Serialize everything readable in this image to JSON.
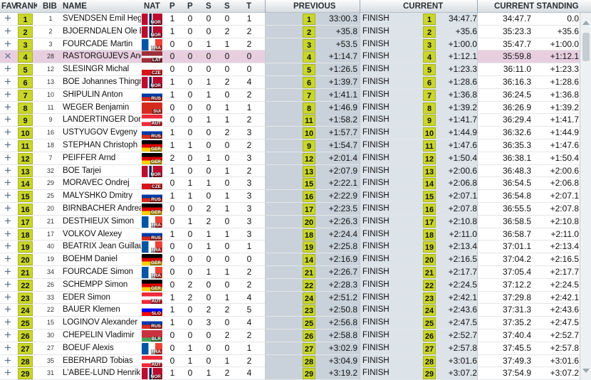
{
  "header": {
    "fav": "FAV",
    "rank": "RANK",
    "bib": "BIB",
    "name": "NAME",
    "nat": "NAT",
    "p1": "P",
    "p2": "P",
    "s1": "S",
    "s2": "S",
    "t": "T",
    "previous": "PREVIOUS",
    "current": "CURRENT",
    "standing": "CURRENT STANDING"
  },
  "colors": {
    "rank_badge": "#c9d62b",
    "selected_row": "#e8cfe0",
    "previous_band": "#c9d2da",
    "current_band": "#dce3e9",
    "fav_icon": "#5c6f86"
  },
  "selected_rank": "4",
  "rows": [
    {
      "fav": "+",
      "rank": "1",
      "bib": "1",
      "name": "SVENDSEN Emil Hegle",
      "nat": "NOR",
      "p1": "1",
      "p2": "0",
      "s1": "0",
      "s2": "0",
      "t": "1",
      "prank": "1",
      "ptime": "33:00.3",
      "status": "FINISH",
      "crank": "1",
      "ctime": "34:47.7",
      "stime": "34:47.7",
      "sdiff": "0.0"
    },
    {
      "fav": "+",
      "rank": "2",
      "bib": "2",
      "name": "BJOERNDALEN Ole Ein",
      "nat": "NOR",
      "p1": "1",
      "p2": "0",
      "s1": "0",
      "s2": "2",
      "t": "2",
      "prank": "2",
      "ptime": "+35.8",
      "status": "FINISH",
      "crank": "2",
      "ctime": "+35.6",
      "stime": "35:23.3",
      "sdiff": "+35.6"
    },
    {
      "fav": "+",
      "rank": "3",
      "bib": "3",
      "name": "FOURCADE Martin",
      "nat": "FRA",
      "p1": "0",
      "p2": "0",
      "s1": "1",
      "s2": "1",
      "t": "2",
      "prank": "3",
      "ptime": "+53.5",
      "status": "FINISH",
      "crank": "3",
      "ctime": "+1:00.0",
      "stime": "35:47.7",
      "sdiff": "+1:00.0"
    },
    {
      "fav": "×",
      "rank": "4",
      "bib": "28",
      "name": "RASTORGUJEVS Andre",
      "nat": "LAT",
      "p1": "0",
      "p2": "0",
      "s1": "0",
      "s2": "0",
      "t": "0",
      "prank": "4",
      "ptime": "+1:14.7",
      "status": "FINISH",
      "crank": "4",
      "ctime": "+1:12.1",
      "stime": "35:59.8",
      "sdiff": "+1:12.1"
    },
    {
      "fav": "+",
      "rank": "5",
      "bib": "12",
      "name": "SLESINGR Michal",
      "nat": "CZE",
      "p1": "0",
      "p2": "0",
      "s1": "0",
      "s2": "0",
      "t": "0",
      "prank": "5",
      "ptime": "+1:26.5",
      "status": "FINISH",
      "crank": "5",
      "ctime": "+1:23.3",
      "stime": "36:11.0",
      "sdiff": "+1:23.3"
    },
    {
      "fav": "+",
      "rank": "6",
      "bib": "13",
      "name": "BOE Johannes Thingn",
      "nat": "NOR",
      "p1": "1",
      "p2": "0",
      "s1": "1",
      "s2": "2",
      "t": "4",
      "prank": "6",
      "ptime": "+1:39.7",
      "status": "FINISH",
      "crank": "6",
      "ctime": "+1:28.6",
      "stime": "36:16.3",
      "sdiff": "+1:28.6"
    },
    {
      "fav": "+",
      "rank": "7",
      "bib": "10",
      "name": "SHIPULIN Anton",
      "nat": "RUS",
      "p1": "1",
      "p2": "0",
      "s1": "1",
      "s2": "0",
      "t": "2",
      "prank": "7",
      "ptime": "+1:41.1",
      "status": "FINISH",
      "crank": "7",
      "ctime": "+1:36.8",
      "stime": "36:24.5",
      "sdiff": "+1:36.8"
    },
    {
      "fav": "+",
      "rank": "8",
      "bib": "11",
      "name": "WEGER Benjamin",
      "nat": "SUI",
      "p1": "0",
      "p2": "0",
      "s1": "0",
      "s2": "1",
      "t": "1",
      "prank": "8",
      "ptime": "+1:46.9",
      "status": "FINISH",
      "crank": "8",
      "ctime": "+1:39.2",
      "stime": "36:26.9",
      "sdiff": "+1:39.2"
    },
    {
      "fav": "+",
      "rank": "9",
      "bib": "9",
      "name": "LANDERTINGER Domir",
      "nat": "AUT",
      "p1": "0",
      "p2": "0",
      "s1": "1",
      "s2": "1",
      "t": "2",
      "prank": "11",
      "ptime": "+1:58.2",
      "status": "FINISH",
      "crank": "9",
      "ctime": "+1:41.7",
      "stime": "36:29.4",
      "sdiff": "+1:41.7"
    },
    {
      "fav": "+",
      "rank": "10",
      "bib": "16",
      "name": "USTYUGOV Evgeny",
      "nat": "RUS",
      "p1": "1",
      "p2": "0",
      "s1": "0",
      "s2": "2",
      "t": "3",
      "prank": "10",
      "ptime": "+1:57.7",
      "status": "FINISH",
      "crank": "10",
      "ctime": "+1:44.9",
      "stime": "36:32.6",
      "sdiff": "+1:44.9"
    },
    {
      "fav": "+",
      "rank": "11",
      "bib": "18",
      "name": "STEPHAN Christoph",
      "nat": "GER",
      "p1": "1",
      "p2": "1",
      "s1": "0",
      "s2": "0",
      "t": "2",
      "prank": "9",
      "ptime": "+1:54.7",
      "status": "FINISH",
      "crank": "11",
      "ctime": "+1:47.6",
      "stime": "36:35.3",
      "sdiff": "+1:47.6"
    },
    {
      "fav": "+",
      "rank": "12",
      "bib": "7",
      "name": "PEIFFER Arnd",
      "nat": "GER",
      "p1": "2",
      "p2": "0",
      "s1": "1",
      "s2": "0",
      "t": "3",
      "prank": "12",
      "ptime": "+2:01.4",
      "status": "FINISH",
      "crank": "12",
      "ctime": "+1:50.4",
      "stime": "36:38.1",
      "sdiff": "+1:50.4"
    },
    {
      "fav": "+",
      "rank": "13",
      "bib": "32",
      "name": "BOE Tarjei",
      "nat": "NOR",
      "p1": "1",
      "p2": "0",
      "s1": "0",
      "s2": "1",
      "t": "2",
      "prank": "13",
      "ptime": "+2:07.9",
      "status": "FINISH",
      "crank": "13",
      "ctime": "+2:00.6",
      "stime": "36:48.3",
      "sdiff": "+2:00.6"
    },
    {
      "fav": "+",
      "rank": "14",
      "bib": "29",
      "name": "MORAVEC Ondrej",
      "nat": "CZE",
      "p1": "0",
      "p2": "1",
      "s1": "1",
      "s2": "0",
      "t": "3",
      "prank": "15",
      "ptime": "+2:22.1",
      "status": "FINISH",
      "crank": "14",
      "ctime": "+2:06.8",
      "stime": "36:54.5",
      "sdiff": "+2:06.8"
    },
    {
      "fav": "+",
      "rank": "15",
      "bib": "25",
      "name": "MALYSHKO Dmitry",
      "nat": "RUS",
      "p1": "1",
      "p2": "1",
      "s1": "0",
      "s2": "1",
      "t": "3",
      "prank": "16",
      "ptime": "+2:22.9",
      "status": "FINISH",
      "crank": "15",
      "ctime": "+2:07.1",
      "stime": "36:54.8",
      "sdiff": "+2:07.1"
    },
    {
      "fav": "+",
      "rank": "16",
      "bib": "20",
      "name": "BIRNBACHER Andreas",
      "nat": "GER",
      "p1": "0",
      "p2": "0",
      "s1": "2",
      "s2": "1",
      "t": "3",
      "prank": "17",
      "ptime": "+2:23.5",
      "status": "FINISH",
      "crank": "16",
      "ctime": "+2:07.8",
      "stime": "36:55.5",
      "sdiff": "+2:07.8"
    },
    {
      "fav": "+",
      "rank": "17",
      "bib": "21",
      "name": "DESTHIEUX Simon",
      "nat": "FRA",
      "p1": "0",
      "p2": "1",
      "s1": "2",
      "s2": "0",
      "t": "3",
      "prank": "20",
      "ptime": "+2:26.3",
      "status": "FINISH",
      "crank": "17",
      "ctime": "+2:10.8",
      "stime": "36:58.5",
      "sdiff": "+2:10.8"
    },
    {
      "fav": "+",
      "rank": "18",
      "bib": "17",
      "name": "VOLKOV Alexey",
      "nat": "RUS",
      "p1": "1",
      "p2": "0",
      "s1": "1",
      "s2": "1",
      "t": "3",
      "prank": "18",
      "ptime": "+2:24.4",
      "status": "FINISH",
      "crank": "18",
      "ctime": "+2:11.0",
      "stime": "36:58.7",
      "sdiff": "+2:11.0"
    },
    {
      "fav": "+",
      "rank": "19",
      "bib": "40",
      "name": "BEATRIX Jean Guillau",
      "nat": "FRA",
      "p1": "0",
      "p2": "0",
      "s1": "1",
      "s2": "0",
      "t": "1",
      "prank": "19",
      "ptime": "+2:25.8",
      "status": "FINISH",
      "crank": "19",
      "ctime": "+2:13.4",
      "stime": "37:01.1",
      "sdiff": "+2:13.4"
    },
    {
      "fav": "+",
      "rank": "20",
      "bib": "19",
      "name": "BOEHM Daniel",
      "nat": "GER",
      "p1": "0",
      "p2": "0",
      "s1": "0",
      "s2": "0",
      "t": "0",
      "prank": "14",
      "ptime": "+2:16.9",
      "status": "FINISH",
      "crank": "20",
      "ctime": "+2:16.5",
      "stime": "37:04.2",
      "sdiff": "+2:16.5"
    },
    {
      "fav": "+",
      "rank": "21",
      "bib": "34",
      "name": "FOURCADE Simon",
      "nat": "FRA",
      "p1": "0",
      "p2": "0",
      "s1": "1",
      "s2": "1",
      "t": "2",
      "prank": "21",
      "ptime": "+2:26.7",
      "status": "FINISH",
      "crank": "21",
      "ctime": "+2:17.7",
      "stime": "37:05.4",
      "sdiff": "+2:17.7"
    },
    {
      "fav": "+",
      "rank": "22",
      "bib": "26",
      "name": "SCHEMPP Simon",
      "nat": "GER",
      "p1": "0",
      "p2": "2",
      "s1": "0",
      "s2": "0",
      "t": "2",
      "prank": "22",
      "ptime": "+2:28.3",
      "status": "FINISH",
      "crank": "22",
      "ctime": "+2:24.5",
      "stime": "37:12.2",
      "sdiff": "+2:24.5"
    },
    {
      "fav": "+",
      "rank": "23",
      "bib": "33",
      "name": "EDER Simon",
      "nat": "AUT",
      "p1": "1",
      "p2": "2",
      "s1": "0",
      "s2": "1",
      "t": "4",
      "prank": "24",
      "ptime": "+2:51.2",
      "status": "FINISH",
      "crank": "23",
      "ctime": "+2:42.1",
      "stime": "37:29.8",
      "sdiff": "+2:42.1"
    },
    {
      "fav": "+",
      "rank": "24",
      "bib": "22",
      "name": "BAUER Klemen",
      "nat": "SLO",
      "p1": "1",
      "p2": "0",
      "s1": "2",
      "s2": "2",
      "t": "5",
      "prank": "23",
      "ptime": "+2:50.8",
      "status": "FINISH",
      "crank": "24",
      "ctime": "+2:43.6",
      "stime": "37:31.3",
      "sdiff": "+2:43.6"
    },
    {
      "fav": "+",
      "rank": "25",
      "bib": "15",
      "name": "LOGINOV Alexander",
      "nat": "RUS",
      "p1": "1",
      "p2": "0",
      "s1": "3",
      "s2": "0",
      "t": "4",
      "prank": "25",
      "ptime": "+2:56.8",
      "status": "FINISH",
      "crank": "25",
      "ctime": "+2:47.5",
      "stime": "37:35.2",
      "sdiff": "+2:47.5"
    },
    {
      "fav": "+",
      "rank": "26",
      "bib": "30",
      "name": "CHEPELIN Vladimir",
      "nat": "BLR",
      "p1": "0",
      "p2": "0",
      "s1": "0",
      "s2": "2",
      "t": "2",
      "prank": "26",
      "ptime": "+2:58.8",
      "status": "FINISH",
      "crank": "26",
      "ctime": "+2:52.7",
      "stime": "37:40.4",
      "sdiff": "+2:52.7"
    },
    {
      "fav": "+",
      "rank": "27",
      "bib": "27",
      "name": "BOEUF Alexis",
      "nat": "FRA",
      "p1": "0",
      "p2": "1",
      "s1": "0",
      "s2": "0",
      "t": "1",
      "prank": "27",
      "ptime": "+3:02.9",
      "status": "FINISH",
      "crank": "27",
      "ctime": "+2:57.8",
      "stime": "37:45.5",
      "sdiff": "+2:57.8"
    },
    {
      "fav": "+",
      "rank": "28",
      "bib": "35",
      "name": "EBERHARD Tobias",
      "nat": "AUT",
      "p1": "0",
      "p2": "1",
      "s1": "0",
      "s2": "1",
      "t": "2",
      "prank": "28",
      "ptime": "+3:04.9",
      "status": "FINISH",
      "crank": "28",
      "ctime": "+3:01.6",
      "stime": "37:49.3",
      "sdiff": "+3:01.6"
    },
    {
      "fav": "+",
      "rank": "29",
      "bib": "31",
      "name": "L'ABEE-LUND Henrik",
      "nat": "NOR",
      "p1": "1",
      "p2": "0",
      "s1": "1",
      "s2": "2",
      "t": "4",
      "prank": "29",
      "ptime": "+3:19.2",
      "status": "FINISH",
      "crank": "29",
      "ctime": "+3:07.2",
      "stime": "37:54.9",
      "sdiff": "+3:07.2"
    }
  ]
}
